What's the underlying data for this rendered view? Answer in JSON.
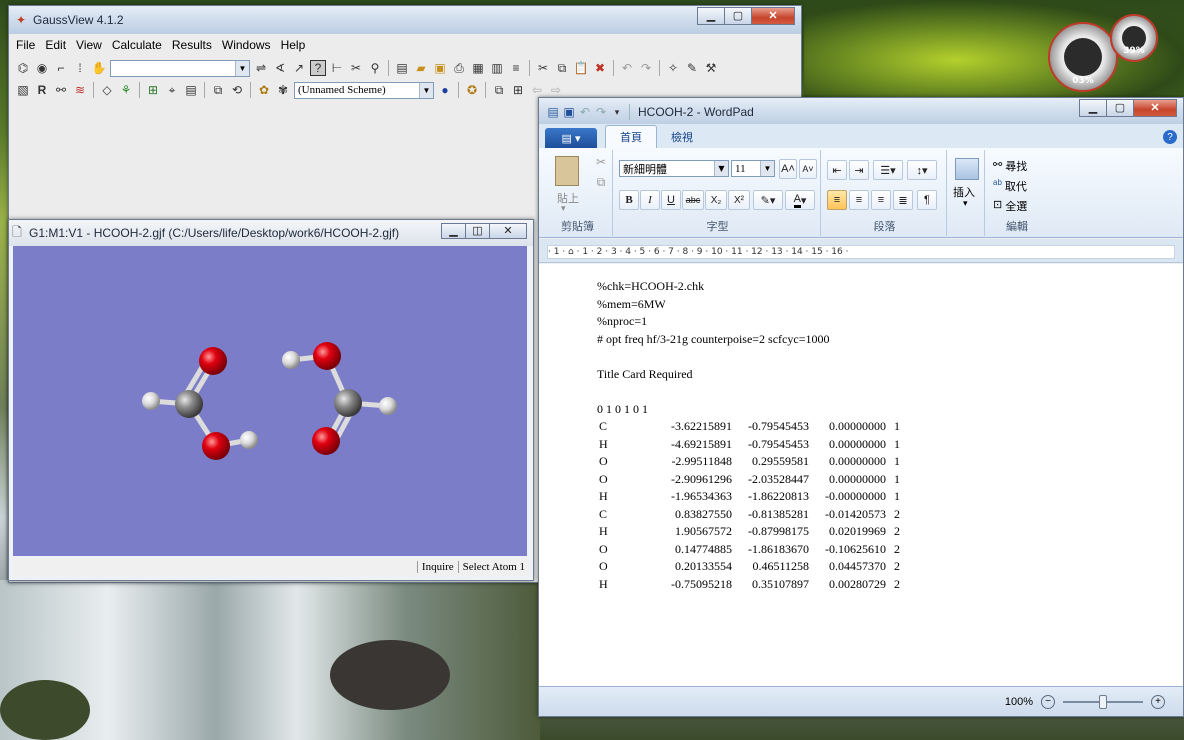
{
  "gaussview": {
    "title": "GaussView 4.1.2",
    "menu": [
      "File",
      "Edit",
      "View",
      "Calculate",
      "Results",
      "Windows",
      "Help"
    ],
    "scheme_value": "(Unnamed Scheme)"
  },
  "molecule_window": {
    "title": "G1:M1:V1 - HCOOH-2.gjf (C:/Users/life/Desktop/work6/HCOOH-2.gjf)",
    "status_mode": "Inquire",
    "status_text": "Select Atom 1",
    "viewport_color": "#7b7dc8",
    "atoms": [
      {
        "el": "O",
        "color": "red"
      },
      {
        "el": "C",
        "color": "gray"
      },
      {
        "el": "H",
        "color": "white"
      },
      {
        "el": "O",
        "color": "red"
      },
      {
        "el": "H",
        "color": "white"
      },
      {
        "el": "O",
        "color": "red"
      },
      {
        "el": "H",
        "color": "white"
      },
      {
        "el": "C",
        "color": "gray"
      },
      {
        "el": "H",
        "color": "white"
      },
      {
        "el": "O",
        "color": "red"
      }
    ]
  },
  "wordpad": {
    "title": "HCOOH-2 - WordPad",
    "tabs": [
      "首頁",
      "檢視"
    ],
    "clipboard": {
      "paste": "貼上",
      "label": "剪貼簿"
    },
    "font": {
      "name": "新細明體",
      "size": "11",
      "label": "字型"
    },
    "paragraph_label": "段落",
    "insert": {
      "button": "插入"
    },
    "editing": {
      "find": "尋找",
      "replace": "取代",
      "select_all": "全選",
      "label": "編輯"
    },
    "ruler_text": "· 1 · ⌂ · 1 · 2 · 3 · 4 · 5 · 6 · 7 · 8 · 9 · 10 · 11 · 12 · 13 · 14 · 15 · 16 ·",
    "doc_lines": [
      "%chk=HCOOH-2.chk",
      "%mem=6MW",
      "%nproc=1",
      "# opt freq hf/3-21g counterpoise=2 scfcyc=1000",
      "",
      "Title Card Required",
      "",
      "0 1 0 1 0 1"
    ],
    "coordinates": [
      {
        "el": "C",
        "x": "-3.62215891",
        "y": "-0.79545453",
        "z": "0.00000000",
        "f": "1"
      },
      {
        "el": "H",
        "x": "-4.69215891",
        "y": "-0.79545453",
        "z": "0.00000000",
        "f": "1"
      },
      {
        "el": "O",
        "x": "-2.99511848",
        "y": "0.29559581",
        "z": "0.00000000",
        "f": "1"
      },
      {
        "el": "O",
        "x": "-2.90961296",
        "y": "-2.03528447",
        "z": "0.00000000",
        "f": "1"
      },
      {
        "el": "H",
        "x": "-1.96534363",
        "y": "-1.86220813",
        "z": "-0.00000000",
        "f": "1"
      },
      {
        "el": "C",
        "x": "0.83827550",
        "y": "-0.81385281",
        "z": "-0.01420573",
        "f": "2"
      },
      {
        "el": "H",
        "x": "1.90567572",
        "y": "-0.87998175",
        "z": "0.02019969",
        "f": "2"
      },
      {
        "el": "O",
        "x": "0.14774885",
        "y": "-1.86183670",
        "z": "-0.10625610",
        "f": "2"
      },
      {
        "el": "O",
        "x": "0.20133554",
        "y": "0.46511258",
        "z": "0.04457370",
        "f": "2"
      },
      {
        "el": "H",
        "x": "-0.75095218",
        "y": "0.35107897",
        "z": "0.00280729",
        "f": "2"
      }
    ],
    "zoom": "100%"
  },
  "gadgets": {
    "cpu_pct": "03%",
    "mem_pct": "39%"
  }
}
